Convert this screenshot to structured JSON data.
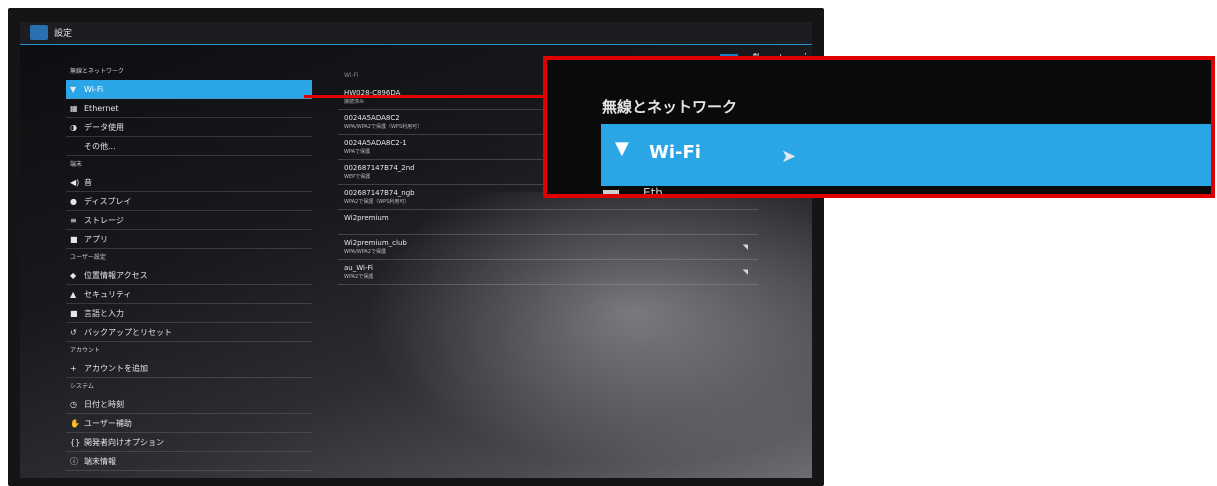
{
  "app": {
    "title": "設定"
  },
  "toolbar": {
    "toggle_label": "ON",
    "wps_icon": "wps-icon",
    "add_icon": "plus-icon",
    "more_icon": "overflow-icon"
  },
  "sidebar": {
    "sections": [
      {
        "header": "無線とネットワーク",
        "items": [
          {
            "icon": "▼",
            "label": "Wi-Fi",
            "selected": true
          },
          {
            "icon": "▦",
            "label": "Ethernet"
          },
          {
            "icon": "◑",
            "label": "データ使用"
          },
          {
            "icon": "",
            "label": "その他..."
          }
        ]
      },
      {
        "header": "端末",
        "items": [
          {
            "icon": "◀)",
            "label": "音"
          },
          {
            "icon": "●",
            "label": "ディスプレイ"
          },
          {
            "icon": "≡",
            "label": "ストレージ"
          },
          {
            "icon": "■",
            "label": "アプリ"
          }
        ]
      },
      {
        "header": "ユーザー設定",
        "items": [
          {
            "icon": "◆",
            "label": "位置情報アクセス"
          },
          {
            "icon": "▲",
            "label": "セキュリティ"
          },
          {
            "icon": "■",
            "label": "言語と入力"
          },
          {
            "icon": "↺",
            "label": "バックアップとリセット"
          }
        ]
      },
      {
        "header": "アカウント",
        "items": [
          {
            "icon": "+",
            "label": "アカウントを追加"
          }
        ]
      },
      {
        "header": "システム",
        "items": [
          {
            "icon": "◷",
            "label": "日付と時刻"
          },
          {
            "icon": "✋",
            "label": "ユーザー補助"
          },
          {
            "icon": "{}",
            "label": "開発者向けオプション"
          },
          {
            "icon": "ⓘ",
            "label": "端末情報"
          }
        ]
      }
    ]
  },
  "wifi": {
    "header": "Wi-Fi",
    "networks": [
      {
        "ssid": "HW028-C896DA",
        "security": "接続済み",
        "signal": ""
      },
      {
        "ssid": "0024A5ADA8C2",
        "security": "WPA/WPA2で保護（WPS利用可）",
        "signal": ""
      },
      {
        "ssid": "0024A5ADA8C2-1",
        "security": "WPAで保護",
        "signal": ""
      },
      {
        "ssid": "002687147B74_2nd",
        "security": "WEPで保護",
        "signal": ""
      },
      {
        "ssid": "002687147B74_ngb",
        "security": "WPA2で保護（WPS利用可）",
        "signal": ""
      },
      {
        "ssid": "Wi2premium",
        "security": "",
        "signal": ""
      },
      {
        "ssid": "Wi2premium_club",
        "security": "WPA/WPA2で保護",
        "signal": "◥"
      },
      {
        "ssid": "au_Wi-Fi",
        "security": "WPA2で保護",
        "signal": "◥"
      }
    ]
  },
  "zoom": {
    "header": "無線とネットワーク",
    "selected_label": "Wi-Fi",
    "next_label": "Eth",
    "highlight_color": "#2aa6e6",
    "frame_color": "#e00000"
  }
}
